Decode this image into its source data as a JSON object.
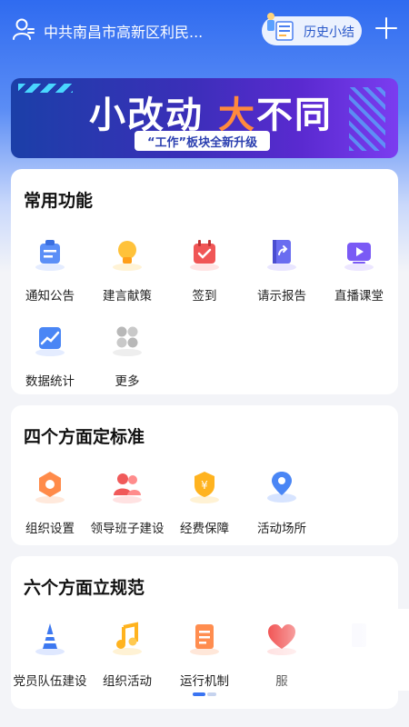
{
  "header": {
    "org_name": "中共南昌市高新区利民...",
    "history_label": "历史小结"
  },
  "banner": {
    "title_part1": "小改动",
    "title_part2": "大",
    "title_part3": "不同",
    "subtitle": "“工作”板块全新升级"
  },
  "sections": [
    {
      "title": "常用功能",
      "items": [
        {
          "label": "通知公告",
          "icon": "announcement-icon"
        },
        {
          "label": "建言献策",
          "icon": "lightbulb-icon"
        },
        {
          "label": "签到",
          "icon": "calendar-check-icon"
        },
        {
          "label": "请示报告",
          "icon": "report-share-icon"
        },
        {
          "label": "直播课堂",
          "icon": "live-play-icon"
        },
        {
          "label": "数据统计",
          "icon": "chart-icon"
        },
        {
          "label": "更多",
          "icon": "more-grid-icon"
        }
      ]
    },
    {
      "title": "四个方面定标准",
      "items": [
        {
          "label": "组织设置",
          "icon": "hexagon-nut-icon"
        },
        {
          "label": "领导班子建设",
          "icon": "team-icon"
        },
        {
          "label": "经费保障",
          "icon": "yuan-shield-icon"
        },
        {
          "label": "活动场所",
          "icon": "location-pin-icon"
        }
      ]
    },
    {
      "title": "六个方面立规范",
      "items": [
        {
          "label": "党员队伍建设",
          "icon": "cone-icon"
        },
        {
          "label": "组织活动",
          "icon": "music-note-icon"
        },
        {
          "label": "运行机制",
          "icon": "document-icon"
        },
        {
          "label": "服",
          "icon": "heart-icon"
        },
        {
          "label": "",
          "icon": "book-icon"
        }
      ]
    }
  ],
  "colors": {
    "primary_blue": "#2f6bf0",
    "banner_accent": "#ff8a3d"
  }
}
